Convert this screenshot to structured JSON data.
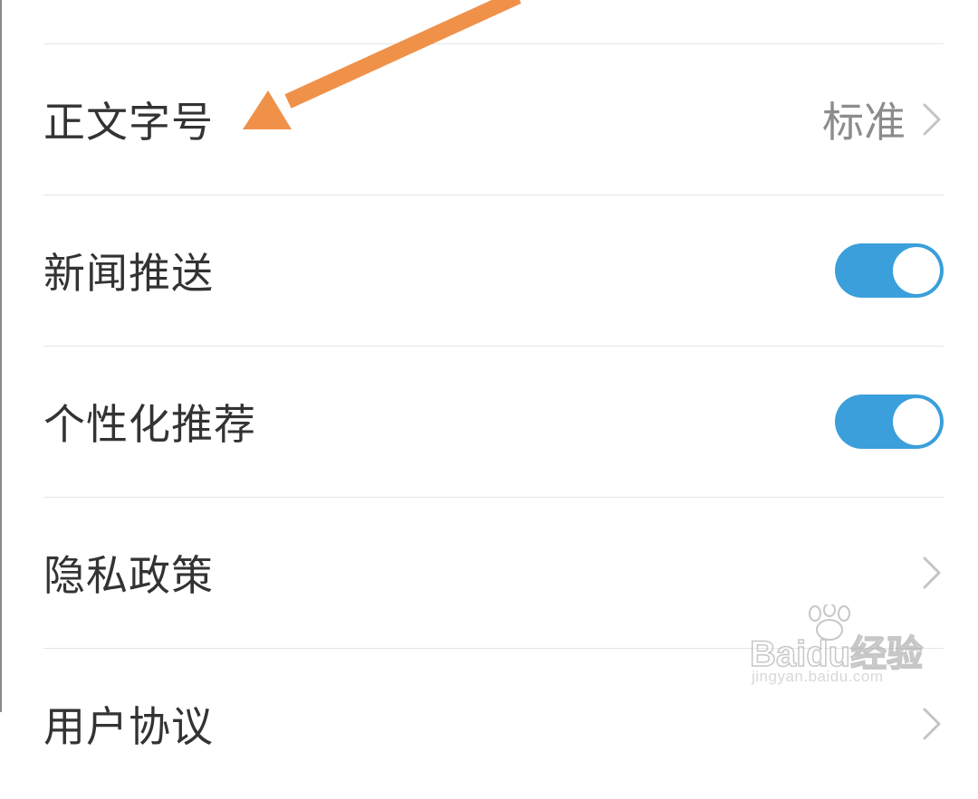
{
  "accent_color": "#3a9fdb",
  "annotation_color": "#f0914a",
  "settings": [
    {
      "label": "正文字号",
      "value": "标准",
      "control": "chevron-right-icon"
    },
    {
      "label": "新闻推送",
      "control": "toggle",
      "state": "on"
    },
    {
      "label": "个性化推荐",
      "control": "toggle",
      "state": "on"
    },
    {
      "label": "隐私政策",
      "control": "chevron-right-icon"
    },
    {
      "label": "用户协议",
      "control": "chevron-right-icon"
    }
  ],
  "watermark": {
    "brand": "Baidu经验",
    "url": "jingyan.baidu.com"
  }
}
